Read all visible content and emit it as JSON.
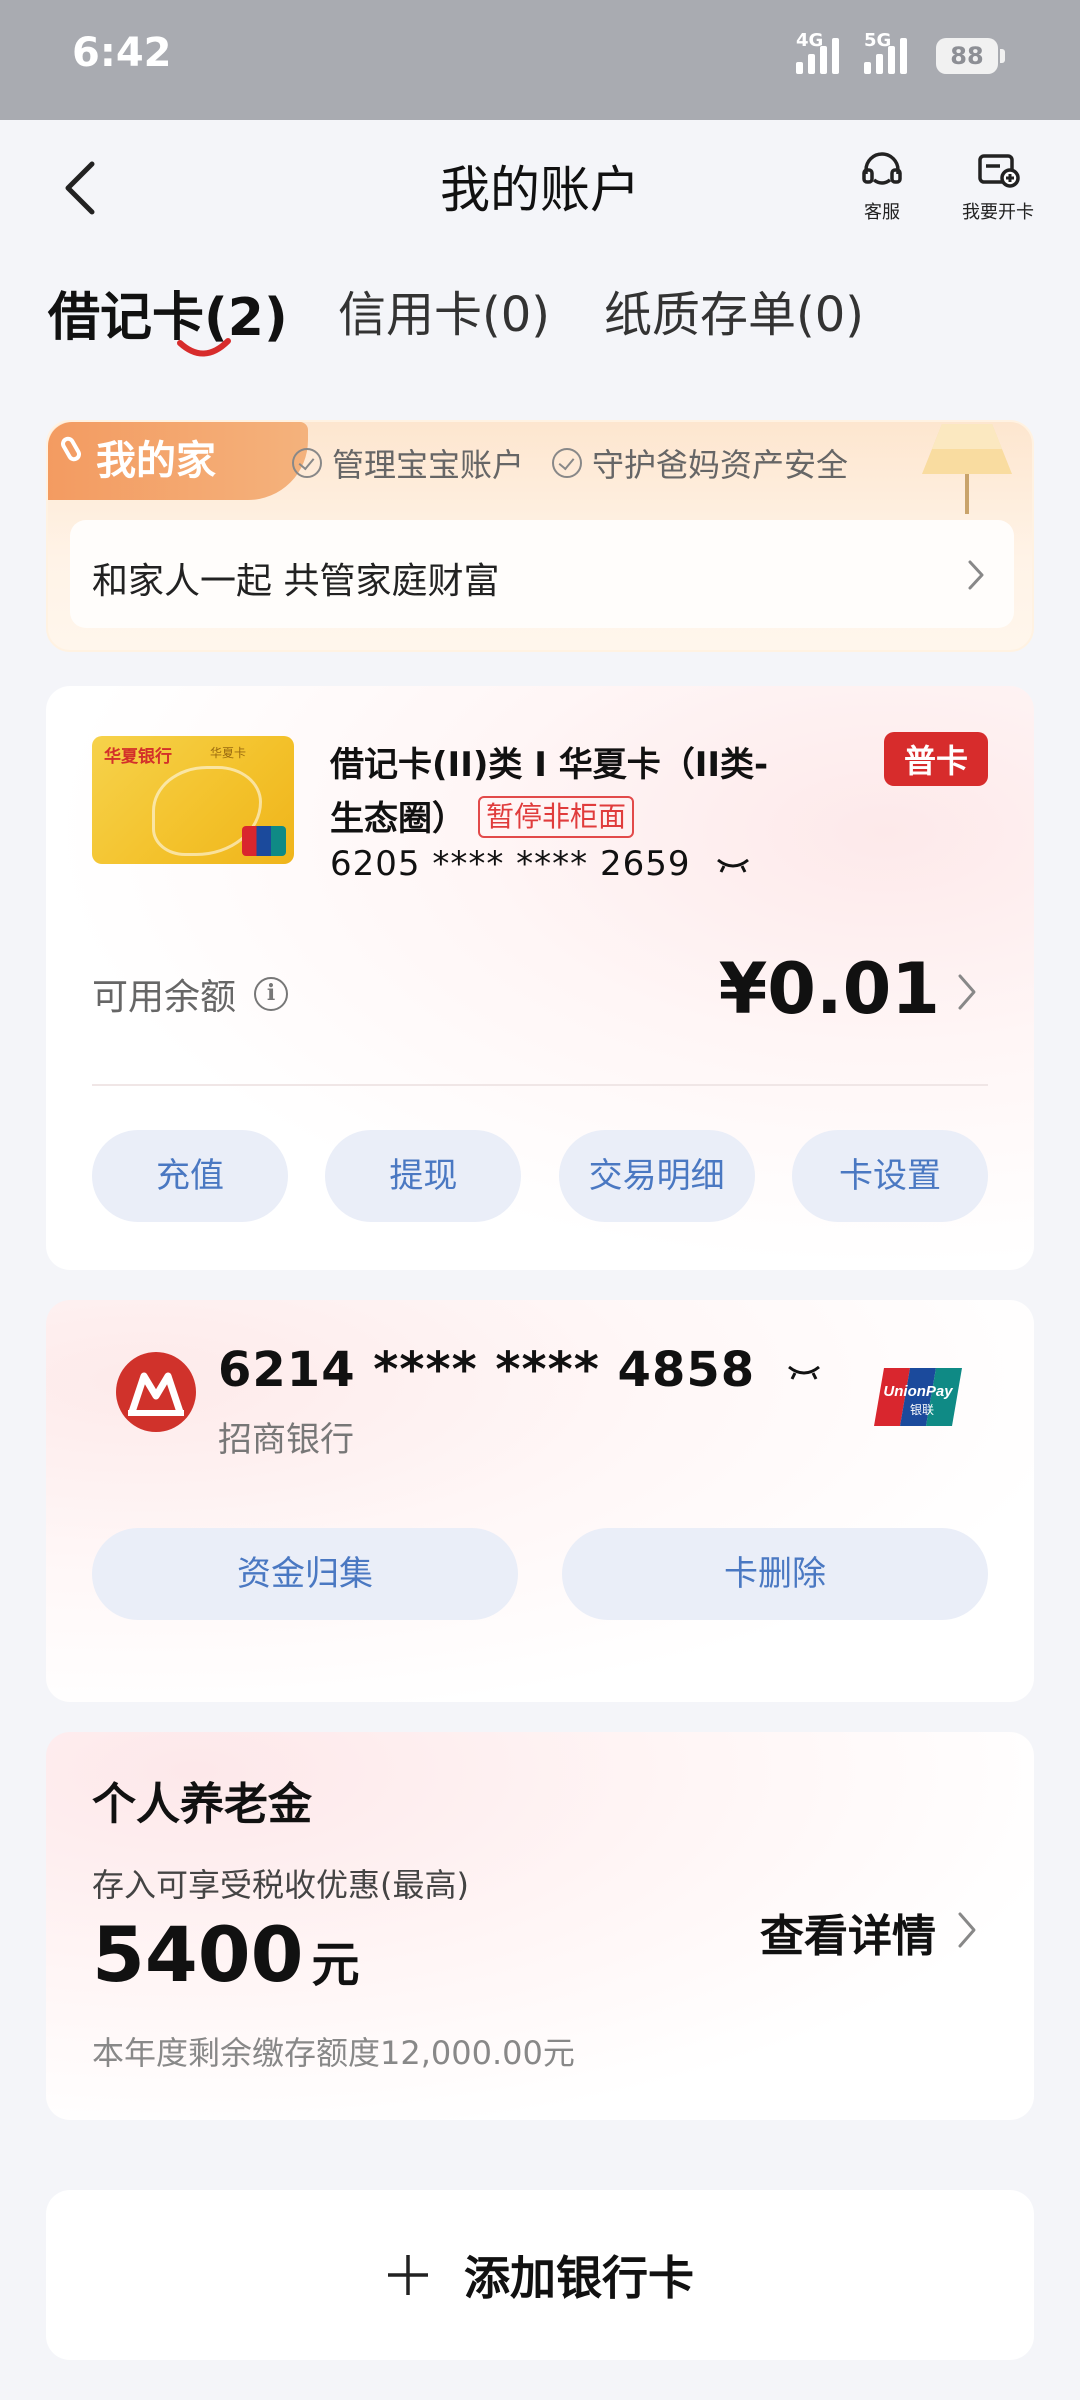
{
  "status_bar": {
    "time": "6:42",
    "net1": "4G",
    "net2": "5G",
    "battery": "88"
  },
  "header": {
    "title": "我的账户",
    "service_label": "客服",
    "open_card_label": "我要开卡"
  },
  "tabs": [
    {
      "label": "借记卡(2)",
      "active": true
    },
    {
      "label": "信用卡(0)",
      "active": false
    },
    {
      "label": "纸质存单(0)",
      "active": false
    }
  ],
  "family": {
    "tag": "我的家",
    "point1": "管理宝宝账户",
    "point2": "守护爸妈资产安全",
    "slogan": "和家人一起 共管家庭财富"
  },
  "card1": {
    "image_bank": "华夏银行",
    "image_sub": "华夏卡",
    "title": "借记卡(II)类 I 华夏卡（II类-生态圈）",
    "status_badge": "暂停非柜面",
    "number": "6205 **** **** 2659",
    "type_badge": "普卡",
    "balance_label": "可用余额",
    "balance_value": "¥0.01",
    "actions": [
      "充值",
      "提现",
      "交易明细",
      "卡设置"
    ]
  },
  "card2": {
    "number": "6214 **** **** 4858",
    "bank": "招商银行",
    "actions": [
      "资金归集",
      "卡删除"
    ]
  },
  "pension": {
    "title": "个人养老金",
    "subtitle": "存入可享受税收优惠(最高)",
    "amount": "5400",
    "unit": "元",
    "note": "本年度剩余缴存额度12,000.00元",
    "link": "查看详情"
  },
  "add_card": {
    "label": "添加银行卡"
  },
  "colors": {
    "accent_blue": "#4a78c2",
    "brand_red": "#d72c2c",
    "pill_bg": "#eaeef8"
  }
}
